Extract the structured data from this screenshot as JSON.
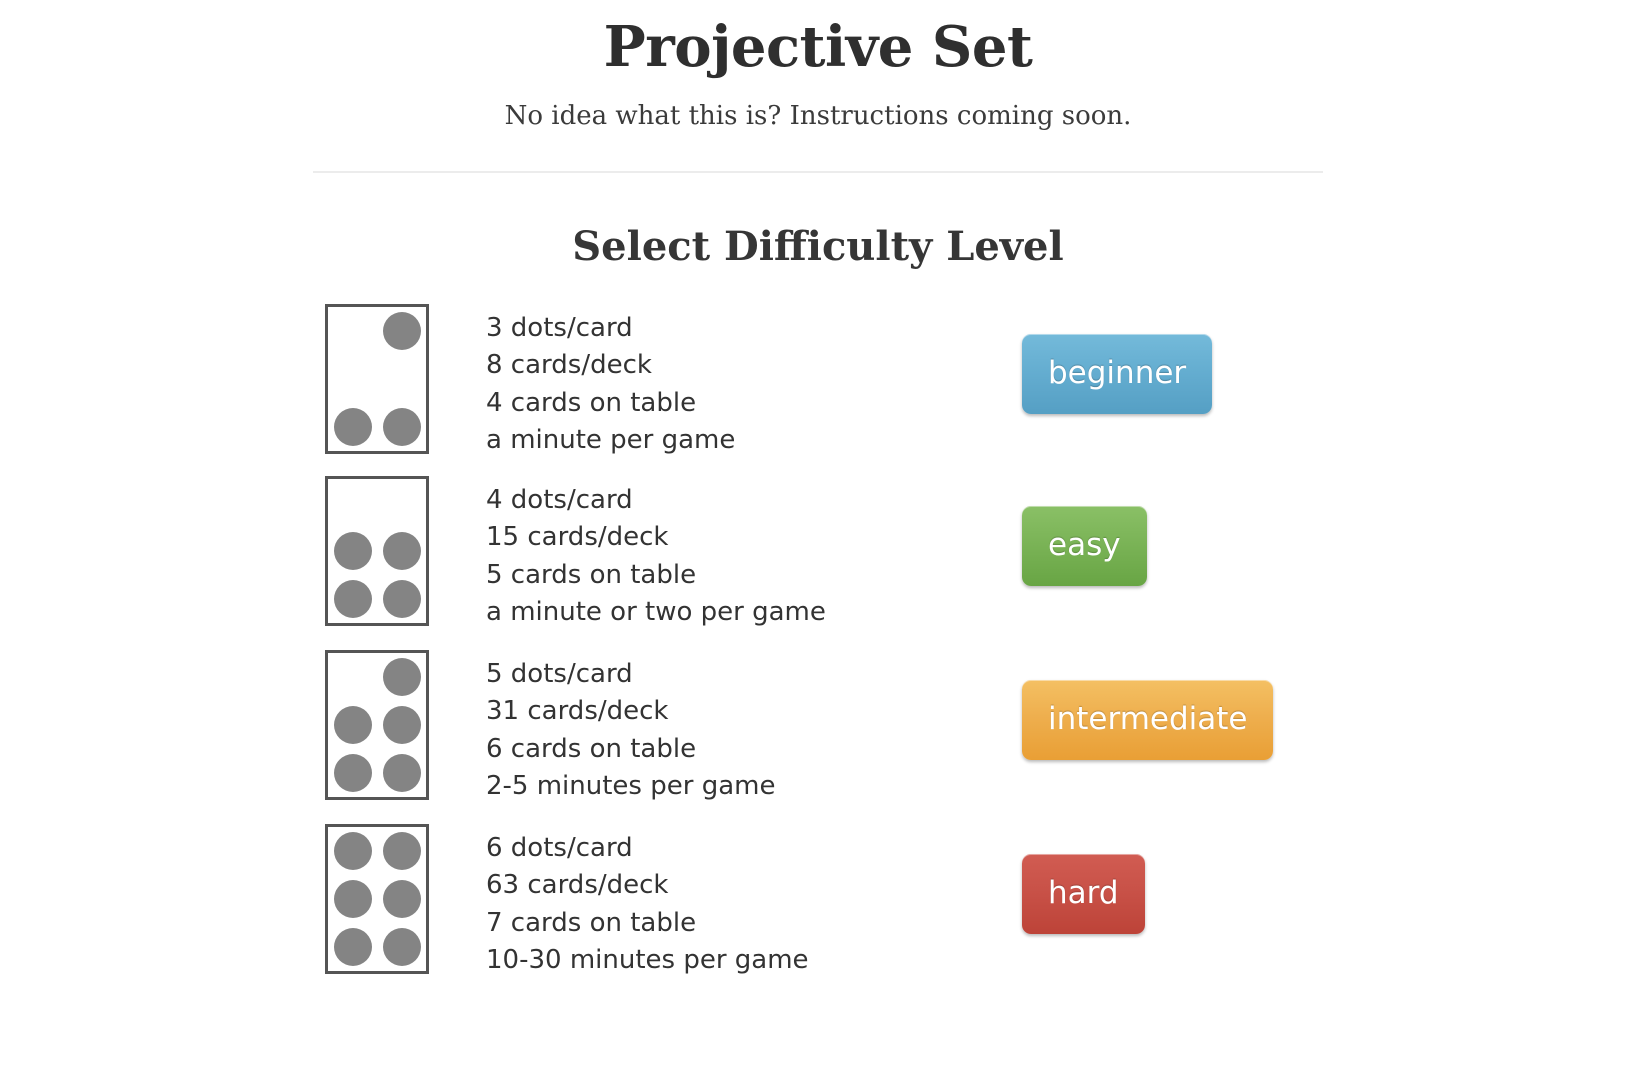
{
  "header": {
    "title": "Projective Set",
    "subtitle": "No idea what this is? Instructions coming soon."
  },
  "section": {
    "title": "Select Difficulty Level"
  },
  "levels": [
    {
      "id": "beginner",
      "dots_label": "3 dots/card",
      "deck_label": "8 cards/deck",
      "table_label": "4 cards on table",
      "time_label": "a minute per game",
      "description": "3 dots/card\n8 cards/deck\n4 cards on table\na minute per game",
      "button_label": "beginner",
      "button_color": "#64add0",
      "dots_count": 3,
      "dot_pattern": [
        false,
        true,
        false,
        false,
        true,
        true
      ]
    },
    {
      "id": "easy",
      "dots_label": "4 dots/card",
      "deck_label": "15 cards/deck",
      "table_label": "5 cards on table",
      "time_label": "a minute or two per game",
      "description": "4 dots/card\n15 cards/deck\n5 cards on table\na minute or two per game",
      "button_label": "easy",
      "button_color": "#7ab356",
      "dots_count": 4,
      "dot_pattern": [
        false,
        false,
        true,
        true,
        true,
        true
      ]
    },
    {
      "id": "intermediate",
      "dots_label": "5 dots/card",
      "deck_label": "31 cards/deck",
      "table_label": "6 cards on table",
      "time_label": "2-5 minutes per game",
      "description": "5 dots/card\n31 cards/deck\n6 cards on table\n2-5 minutes per game",
      "button_label": "intermediate",
      "button_color": "#eeae4d",
      "dots_count": 5,
      "dot_pattern": [
        false,
        true,
        true,
        true,
        true,
        true
      ]
    },
    {
      "id": "hard",
      "dots_label": "6 dots/card",
      "deck_label": "63 cards/deck",
      "table_label": "7 cards on table",
      "time_label": "10-30 minutes per game",
      "description": "6 dots/card\n63 cards/deck\n7 cards on table\n10-30 minutes per game",
      "button_label": "hard",
      "button_color": "#c85147",
      "dots_count": 6,
      "dot_pattern": [
        true,
        true,
        true,
        true,
        true,
        true
      ]
    }
  ]
}
